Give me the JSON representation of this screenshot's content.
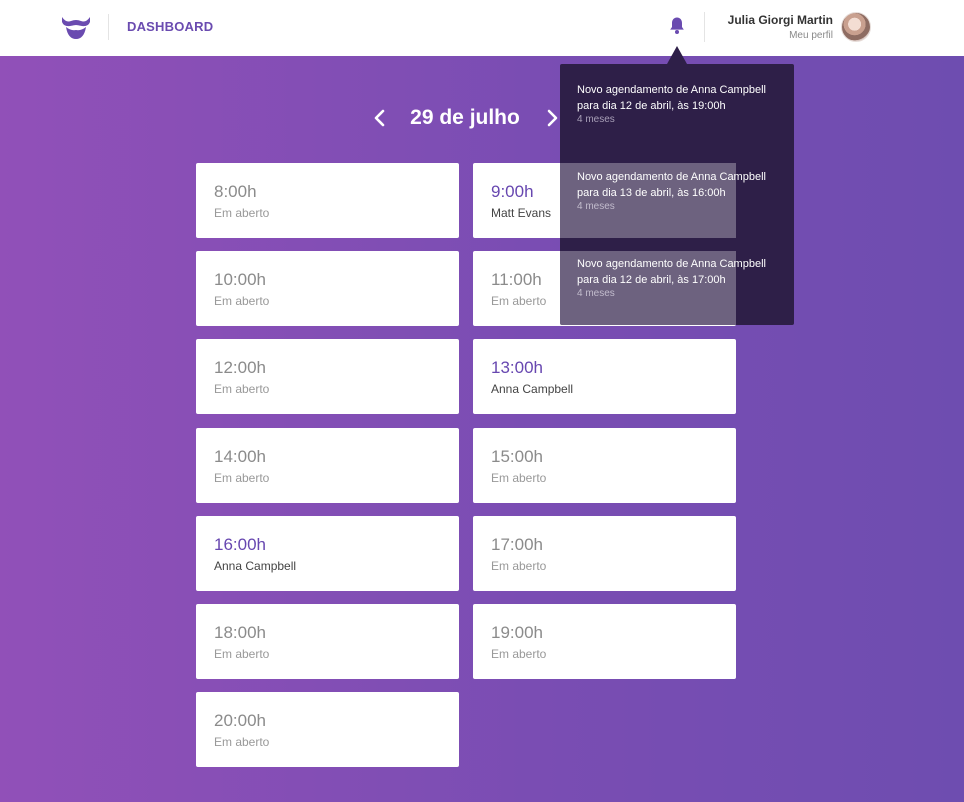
{
  "header": {
    "logo_icon": "mustache-logo-icon",
    "nav_label": "DASHBOARD",
    "notifications_icon": "bell-icon",
    "user": {
      "name": "Julia Giorgi Martin",
      "profile_link": "Meu perfil"
    }
  },
  "date_nav": {
    "label": "29 de julho",
    "prev_icon": "chevron-left-icon",
    "next_icon": "chevron-right-icon"
  },
  "slots": [
    {
      "time": "8:00h",
      "name": "Em aberto",
      "booked": false
    },
    {
      "time": "9:00h",
      "name": "Matt Evans",
      "booked": true
    },
    {
      "time": "10:00h",
      "name": "Em aberto",
      "booked": false
    },
    {
      "time": "11:00h",
      "name": "Em aberto",
      "booked": false
    },
    {
      "time": "12:00h",
      "name": "Em aberto",
      "booked": false
    },
    {
      "time": "13:00h",
      "name": "Anna Campbell",
      "booked": true
    },
    {
      "time": "14:00h",
      "name": "Em aberto",
      "booked": false
    },
    {
      "time": "15:00h",
      "name": "Em aberto",
      "booked": false
    },
    {
      "time": "16:00h",
      "name": "Anna Campbell",
      "booked": true
    },
    {
      "time": "17:00h",
      "name": "Em aberto",
      "booked": false
    },
    {
      "time": "18:00h",
      "name": "Em aberto",
      "booked": false
    },
    {
      "time": "19:00h",
      "name": "Em aberto",
      "booked": false
    },
    {
      "time": "20:00h",
      "name": "Em aberto",
      "booked": false
    }
  ],
  "notifications": [
    {
      "message": "Novo agendamento de Anna Campbell para dia 12 de abril, às 19:00h",
      "ago": "4 meses"
    },
    {
      "message": "Novo agendamento de Anna Campbell para dia 13 de abril, às 16:00h",
      "ago": "4 meses"
    },
    {
      "message": "Novo agendamento de Anna Campbell para dia 12 de abril, às 17:00h",
      "ago": "4 meses"
    }
  ],
  "colors": {
    "accent": "#6747b0",
    "gradient_start": "#9150b8",
    "gradient_end": "#6e4db0",
    "panel": "#2e1f48"
  }
}
